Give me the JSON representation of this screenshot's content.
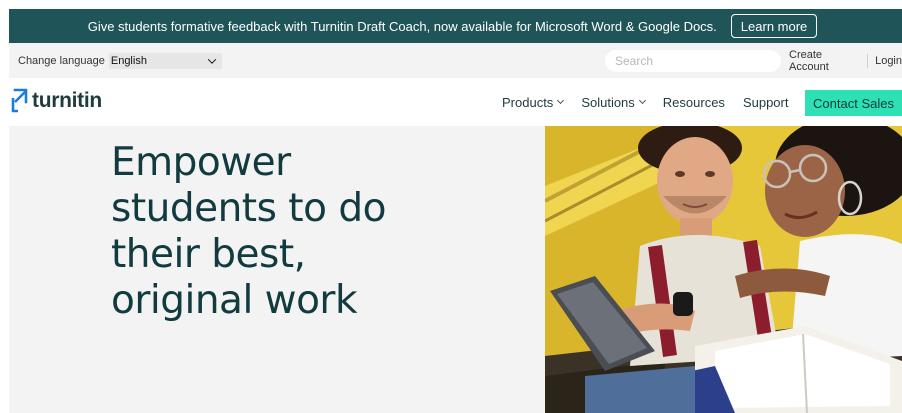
{
  "announcement": {
    "text": "Give students formative feedback with Turnitin Draft Coach, now available for Microsoft Word & Google Docs.",
    "button_label": "Learn more"
  },
  "utility_bar": {
    "language_label": "Change language",
    "language_selected": "English",
    "search_placeholder": "Search",
    "create_account_label": "Create Account",
    "login_label": "Login"
  },
  "nav": {
    "logo_text": "turnitin",
    "items": [
      {
        "label": "Products",
        "has_dropdown": true
      },
      {
        "label": "Solutions",
        "has_dropdown": true
      },
      {
        "label": "Resources",
        "has_dropdown": false
      },
      {
        "label": "Support",
        "has_dropdown": false
      }
    ],
    "cta_label": "Contact Sales"
  },
  "hero": {
    "headline_lines": [
      "Empower",
      "students to do",
      "their best,",
      "original work"
    ]
  },
  "colors": {
    "announcement_bg": "#1f5559",
    "cta_bg": "#2de1b4",
    "headline": "#113b3f",
    "logo_blue": "#1a7fd4"
  }
}
